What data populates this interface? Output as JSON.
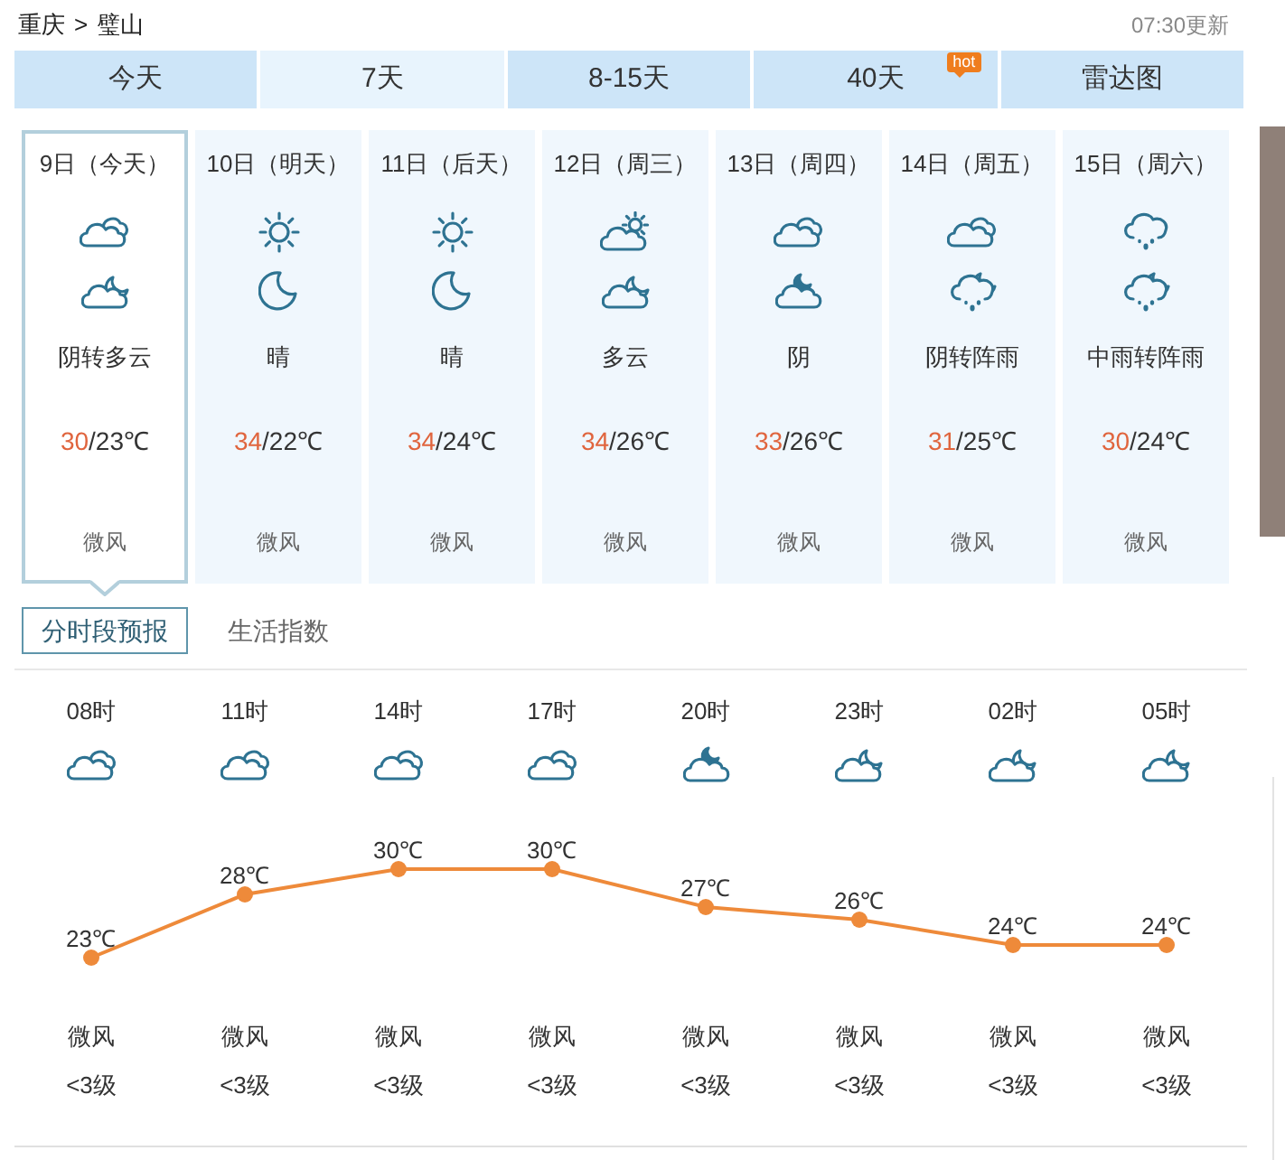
{
  "breadcrumb": {
    "items": [
      {
        "label": "重庆"
      },
      {
        "label": "璧山"
      }
    ],
    "separator": ">"
  },
  "update_time": "07:30更新",
  "tabs": [
    {
      "label": "今天",
      "selected": false
    },
    {
      "label": "7天",
      "selected": true
    },
    {
      "label": "8-15天",
      "selected": false
    },
    {
      "label": "40天",
      "selected": false,
      "badge": "hot"
    },
    {
      "label": "雷达图",
      "selected": false
    }
  ],
  "days": [
    {
      "date": "9日（今天）",
      "icons": [
        {
          "kind": "overcast"
        },
        {
          "kind": "cloudy-night"
        }
      ],
      "weather": "阴转多云",
      "high": "30",
      "low": "/23℃",
      "wind": "微风",
      "selected": true
    },
    {
      "date": "10日（明天）",
      "icons": [
        {
          "kind": "sunny"
        },
        {
          "kind": "clear-night"
        }
      ],
      "weather": "晴",
      "high": "34",
      "low": "/22℃",
      "wind": "微风",
      "selected": false
    },
    {
      "date": "11日（后天）",
      "icons": [
        {
          "kind": "sunny"
        },
        {
          "kind": "clear-night"
        }
      ],
      "weather": "晴",
      "high": "34",
      "low": "/24℃",
      "wind": "微风",
      "selected": false
    },
    {
      "date": "12日（周三）",
      "icons": [
        {
          "kind": "partly-cloudy"
        },
        {
          "kind": "cloudy-night"
        }
      ],
      "weather": "多云",
      "high": "34",
      "low": "/26℃",
      "wind": "微风",
      "selected": false
    },
    {
      "date": "13日（周四）",
      "icons": [
        {
          "kind": "overcast"
        },
        {
          "kind": "overcast-night"
        }
      ],
      "weather": "阴",
      "high": "33",
      "low": "/26℃",
      "wind": "微风",
      "selected": false
    },
    {
      "date": "14日（周五）",
      "icons": [
        {
          "kind": "overcast"
        },
        {
          "kind": "shower-night"
        }
      ],
      "weather": "阴转阵雨",
      "high": "31",
      "low": "/25℃",
      "wind": "微风",
      "selected": false
    },
    {
      "date": "15日（周六）",
      "icons": [
        {
          "kind": "rain"
        },
        {
          "kind": "shower-night"
        }
      ],
      "weather": "中雨转阵雨",
      "high": "30",
      "low": "/24℃",
      "wind": "微风",
      "selected": false
    }
  ],
  "subtabs": [
    {
      "label": "分时段预报",
      "selected": true
    },
    {
      "label": "生活指数",
      "selected": false
    }
  ],
  "hourly": {
    "hours": [
      {
        "time": "08时",
        "icon": {
          "kind": "overcast"
        },
        "wind": "微风",
        "wind_level": "<3级"
      },
      {
        "time": "11时",
        "icon": {
          "kind": "overcast"
        },
        "wind": "微风",
        "wind_level": "<3级"
      },
      {
        "time": "14时",
        "icon": {
          "kind": "overcast"
        },
        "wind": "微风",
        "wind_level": "<3级"
      },
      {
        "time": "17时",
        "icon": {
          "kind": "overcast"
        },
        "wind": "微风",
        "wind_level": "<3级"
      },
      {
        "time": "20时",
        "icon": {
          "kind": "overcast-night"
        },
        "wind": "微风",
        "wind_level": "<3级"
      },
      {
        "time": "23时",
        "icon": {
          "kind": "cloudy-night"
        },
        "wind": "微风",
        "wind_level": "<3级"
      },
      {
        "time": "02时",
        "icon": {
          "kind": "cloudy-night"
        },
        "wind": "微风",
        "wind_level": "<3级"
      },
      {
        "time": "05时",
        "icon": {
          "kind": "cloudy-night"
        },
        "wind": "微风",
        "wind_level": "<3级"
      }
    ],
    "chart_data": {
      "type": "line",
      "ylabel": "℃",
      "series": [
        {
          "color": "#ee8a3a",
          "marker": "circle",
          "values": [
            23,
            28,
            30,
            30,
            27,
            26,
            24,
            24
          ]
        }
      ],
      "data_labels": true
    }
  }
}
